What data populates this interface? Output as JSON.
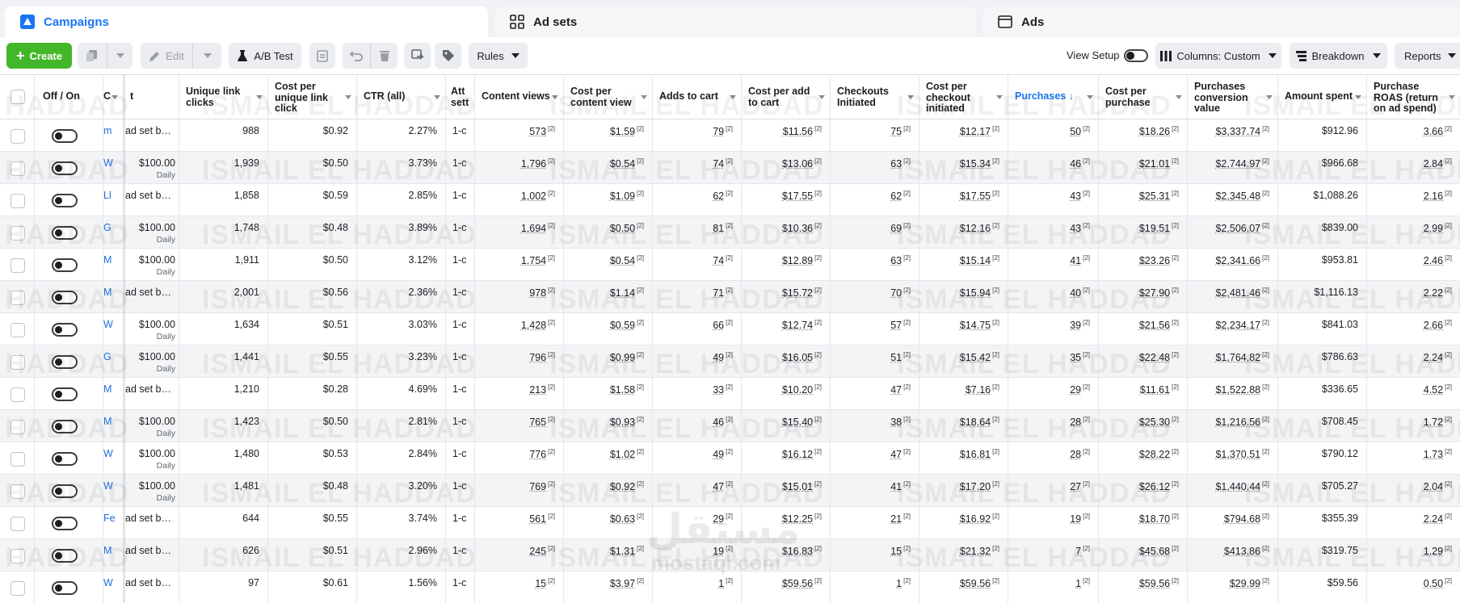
{
  "tabs": [
    {
      "label": "Campaigns",
      "icon": "campaign-flag-icon",
      "active": true
    },
    {
      "label": "Ad sets",
      "icon": "grid-icon",
      "active": false
    },
    {
      "label": "Ads",
      "icon": "ad-window-icon",
      "active": false
    }
  ],
  "toolbar": {
    "create_label": "Create",
    "edit_label": "Edit",
    "ab_test_label": "A/B Test",
    "rules_label": "Rules",
    "view_setup_label": "View Setup",
    "columns_label": "Columns: Custom",
    "breakdown_label": "Breakdown",
    "reports_label": "Reports"
  },
  "colors": {
    "brand": "#1877f2",
    "create": "#42b72a"
  },
  "headers": {
    "offon": "Off / On",
    "name": "C",
    "budget": "t",
    "unique_link_clicks": "Unique link clicks",
    "cost_per_unique_link_click": "Cost per unique link click",
    "ctr": "CTR (all)",
    "attribution": "Att sett",
    "content_views": "Content views",
    "cost_per_content_view": "Cost per content view",
    "adds_to_cart": "Adds to cart",
    "cost_per_add_to_cart": "Cost per add to cart",
    "checkouts": "Checkouts Initiated",
    "cost_per_checkout": "Cost per checkout initiated",
    "purchases": "Purchases ↓",
    "cost_per_purchase": "Cost per purchase",
    "purchase_value": "Purchases conversion value",
    "amount_spent": "Amount spent",
    "roas": "Purchase ROAS (return on ad spend)"
  },
  "rows": [
    {
      "name": "m",
      "budget": "ad set b…",
      "daily": "",
      "ulc": "988",
      "culc": "$0.92",
      "ctr": "2.27%",
      "att": "1-c",
      "cv": "573",
      "ccv": "$1.59",
      "atc": "79",
      "catc": "$11.56",
      "ci": "75",
      "cci": "$12.17",
      "p": "50",
      "cpp": "$18.26",
      "pv": "$3,337.74",
      "spent": "$912.96",
      "roas": "3.66"
    },
    {
      "name": "W",
      "budget": "$100.00",
      "daily": "Daily",
      "ulc": "1,939",
      "culc": "$0.50",
      "ctr": "3.73%",
      "att": "1-c",
      "cv": "1,796",
      "ccv": "$0.54",
      "atc": "74",
      "catc": "$13.06",
      "ci": "63",
      "cci": "$15.34",
      "p": "46",
      "cpp": "$21.01",
      "pv": "$2,744.97",
      "spent": "$966.68",
      "roas": "2.84"
    },
    {
      "name": "Ll",
      "budget": "ad set b…",
      "daily": "",
      "ulc": "1,858",
      "culc": "$0.59",
      "ctr": "2.85%",
      "att": "1-c",
      "cv": "1,002",
      "ccv": "$1.09",
      "atc": "62",
      "catc": "$17.55",
      "ci": "62",
      "cci": "$17.55",
      "p": "43",
      "cpp": "$25.31",
      "pv": "$2,345.48",
      "spent": "$1,088.26",
      "roas": "2.16"
    },
    {
      "name": "G",
      "budget": "$100.00",
      "daily": "Daily",
      "ulc": "1,748",
      "culc": "$0.48",
      "ctr": "3.89%",
      "att": "1-c",
      "cv": "1,694",
      "ccv": "$0.50",
      "atc": "81",
      "catc": "$10.36",
      "ci": "69",
      "cci": "$12.16",
      "p": "43",
      "cpp": "$19.51",
      "pv": "$2,506.07",
      "spent": "$839.00",
      "roas": "2.99"
    },
    {
      "name": "M",
      "budget": "$100.00",
      "daily": "Daily",
      "ulc": "1,911",
      "culc": "$0.50",
      "ctr": "3.12%",
      "att": "1-c",
      "cv": "1,754",
      "ccv": "$0.54",
      "atc": "74",
      "catc": "$12.89",
      "ci": "63",
      "cci": "$15.14",
      "p": "41",
      "cpp": "$23.26",
      "pv": "$2,341.66",
      "spent": "$953.81",
      "roas": "2.46"
    },
    {
      "name": "M",
      "budget": "ad set b…",
      "daily": "",
      "ulc": "2,001",
      "culc": "$0.56",
      "ctr": "2.36%",
      "att": "1-c",
      "cv": "978",
      "ccv": "$1.14",
      "atc": "71",
      "catc": "$15.72",
      "ci": "70",
      "cci": "$15.94",
      "p": "40",
      "cpp": "$27.90",
      "pv": "$2,481.46",
      "spent": "$1,116.13",
      "roas": "2.22"
    },
    {
      "name": "W",
      "budget": "$100.00",
      "daily": "Daily",
      "ulc": "1,634",
      "culc": "$0.51",
      "ctr": "3.03%",
      "att": "1-c",
      "cv": "1,428",
      "ccv": "$0.59",
      "atc": "66",
      "catc": "$12.74",
      "ci": "57",
      "cci": "$14.75",
      "p": "39",
      "cpp": "$21.56",
      "pv": "$2,234.17",
      "spent": "$841.03",
      "roas": "2.66"
    },
    {
      "name": "G",
      "budget": "$100.00",
      "daily": "Daily",
      "ulc": "1,441",
      "culc": "$0.55",
      "ctr": "3.23%",
      "att": "1-c",
      "cv": "796",
      "ccv": "$0.99",
      "atc": "49",
      "catc": "$16.05",
      "ci": "51",
      "cci": "$15.42",
      "p": "35",
      "cpp": "$22.48",
      "pv": "$1,764.82",
      "spent": "$786.63",
      "roas": "2.24"
    },
    {
      "name": "M",
      "budget": "ad set b…",
      "daily": "",
      "ulc": "1,210",
      "culc": "$0.28",
      "ctr": "4.69%",
      "att": "1-c",
      "cv": "213",
      "ccv": "$1.58",
      "atc": "33",
      "catc": "$10.20",
      "ci": "47",
      "cci": "$7.16",
      "p": "29",
      "cpp": "$11.61",
      "pv": "$1,522.88",
      "spent": "$336.65",
      "roas": "4.52"
    },
    {
      "name": "M",
      "budget": "$100.00",
      "daily": "Daily",
      "ulc": "1,423",
      "culc": "$0.50",
      "ctr": "2.81%",
      "att": "1-c",
      "cv": "765",
      "ccv": "$0.93",
      "atc": "46",
      "catc": "$15.40",
      "ci": "38",
      "cci": "$18.64",
      "p": "28",
      "cpp": "$25.30",
      "pv": "$1,216.56",
      "spent": "$708.45",
      "roas": "1.72"
    },
    {
      "name": "W",
      "budget": "$100.00",
      "daily": "Daily",
      "ulc": "1,480",
      "culc": "$0.53",
      "ctr": "2.84%",
      "att": "1-c",
      "cv": "776",
      "ccv": "$1.02",
      "atc": "49",
      "catc": "$16.12",
      "ci": "47",
      "cci": "$16.81",
      "p": "28",
      "cpp": "$28.22",
      "pv": "$1,370.51",
      "spent": "$790.12",
      "roas": "1.73"
    },
    {
      "name": "W",
      "budget": "$100.00",
      "daily": "Daily",
      "ulc": "1,481",
      "culc": "$0.48",
      "ctr": "3.20%",
      "att": "1-c",
      "cv": "769",
      "ccv": "$0.92",
      "atc": "47",
      "catc": "$15.01",
      "ci": "41",
      "cci": "$17.20",
      "p": "27",
      "cpp": "$26.12",
      "pv": "$1,440.44",
      "spent": "$705.27",
      "roas": "2.04"
    },
    {
      "name": "Fe",
      "budget": "ad set b…",
      "daily": "",
      "ulc": "644",
      "culc": "$0.55",
      "ctr": "3.74%",
      "att": "1-c",
      "cv": "561",
      "ccv": "$0.63",
      "atc": "29",
      "catc": "$12.25",
      "ci": "21",
      "cci": "$16.92",
      "p": "19",
      "cpp": "$18.70",
      "pv": "$794.68",
      "spent": "$355.39",
      "roas": "2.24"
    },
    {
      "name": "M",
      "budget": "ad set b…",
      "daily": "",
      "ulc": "626",
      "culc": "$0.51",
      "ctr": "2.96%",
      "att": "1-c",
      "cv": "245",
      "ccv": "$1.31",
      "atc": "19",
      "catc": "$16.83",
      "ci": "15",
      "cci": "$21.32",
      "p": "7",
      "cpp": "$45.68",
      "pv": "$413.86",
      "spent": "$319.75",
      "roas": "1.29"
    },
    {
      "name": "W",
      "budget": "ad set b…",
      "daily": "",
      "ulc": "97",
      "culc": "$0.61",
      "ctr": "1.56%",
      "att": "1-c",
      "cv": "15",
      "ccv": "$3.97",
      "atc": "1",
      "catc": "$59.56",
      "ci": "1",
      "cci": "$59.56",
      "p": "1",
      "cpp": "$59.56",
      "pv": "$29.99",
      "spent": "$59.56",
      "roas": "0.50"
    }
  ],
  "footnote_marker": "[2]",
  "watermark": "ISMAIL EL HADDAD",
  "logo_watermark": "mostaql.com"
}
